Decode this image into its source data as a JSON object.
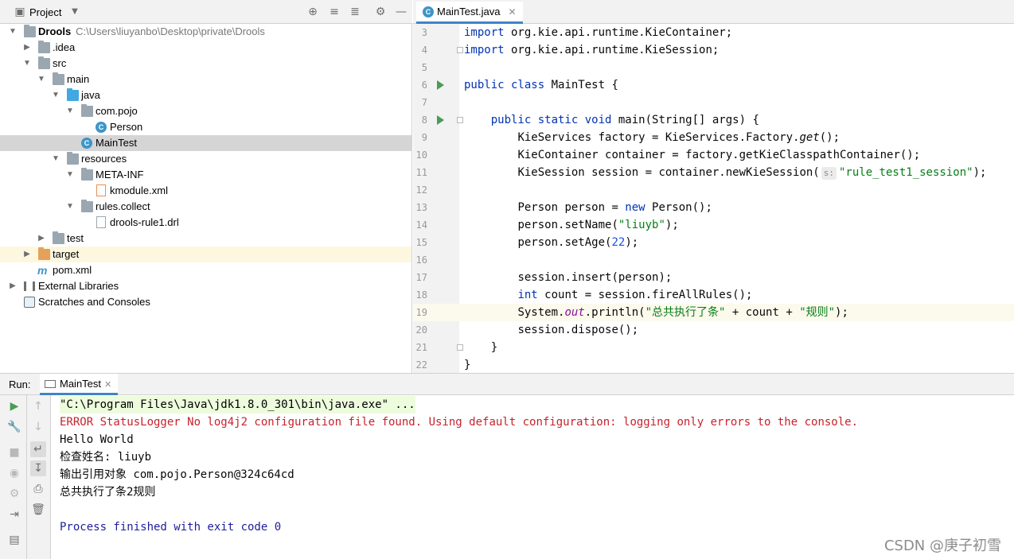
{
  "project": {
    "title": "Project",
    "tree": [
      {
        "label": "Drools",
        "path": "C:\\Users\\liuyanbo\\Desktop\\private\\Drools",
        "icon": "module-folder-icon"
      },
      {
        "label": ".idea",
        "icon": "folder-icon"
      },
      {
        "label": "src",
        "icon": "folder-icon"
      },
      {
        "label": "main",
        "icon": "folder-icon"
      },
      {
        "label": "java",
        "icon": "source-folder-icon"
      },
      {
        "label": "com.pojo",
        "icon": "package-icon"
      },
      {
        "label": "Person",
        "icon": "class-icon"
      },
      {
        "label": "MainTest",
        "icon": "runnable-class-icon"
      },
      {
        "label": "resources",
        "icon": "resources-folder-icon"
      },
      {
        "label": "META-INF",
        "icon": "folder-icon"
      },
      {
        "label": "kmodule.xml",
        "icon": "xml-file-icon"
      },
      {
        "label": "rules.collect",
        "icon": "folder-icon"
      },
      {
        "label": "drools-rule1.drl",
        "icon": "file-icon"
      },
      {
        "label": "test",
        "icon": "folder-icon"
      },
      {
        "label": "target",
        "icon": "excluded-folder-icon"
      },
      {
        "label": "pom.xml",
        "icon": "maven-icon"
      },
      {
        "label": "External Libraries",
        "icon": "library-icon"
      },
      {
        "label": "Scratches and Consoles",
        "icon": "scratches-icon"
      }
    ]
  },
  "editor": {
    "tab_label": "MainTest.java",
    "line_numbers": [
      "3",
      "4",
      "5",
      "6",
      "7",
      "8",
      "9",
      "10",
      "11",
      "12",
      "13",
      "14",
      "15",
      "16",
      "17",
      "18",
      "19",
      "20",
      "21",
      "22"
    ],
    "hint_label": "s:",
    "code": {
      "l3_kw": "import",
      "l3_rest": " org.kie.api.runtime.KieContainer;",
      "l4_kw": "import",
      "l4_rest": " org.kie.api.runtime.KieSession;",
      "l6_kw": "public class",
      "l6_rest": " MainTest {",
      "l8_kw": "public static void",
      "l8_rest": " main(String[] args) {",
      "l9_a": "KieServices factory = KieServices.Factory.",
      "l9_m": "get",
      "l9_b": "();",
      "l10": "KieContainer container = factory.getKieClasspathContainer();",
      "l11_a": "KieSession session = container.newKieSession(",
      "l11_s": "\"rule_test1_session\"",
      "l11_b": ");",
      "l13_a": "Person person = ",
      "l13_kw": "new",
      "l13_b": " Person();",
      "l14_a": "person.setName(",
      "l14_s": "\"liuyb\"",
      "l14_b": ");",
      "l15_a": "person.setAge(",
      "l15_n": "22",
      "l15_b": ");",
      "l17": "session.insert(person);",
      "l18_kw": "int",
      "l18_rest": " count = session.fireAllRules();",
      "l19_a": "System.",
      "l19_out": "out",
      "l19_b": ".println(",
      "l19_s1": "\"总共执行了条\"",
      "l19_c": " + count + ",
      "l19_s2": "\"规则\"",
      "l19_d": ");",
      "l20": "session.dispose();",
      "l21": "}",
      "l22": "}"
    }
  },
  "run": {
    "label": "Run:",
    "tab_label": "MainTest",
    "output": [
      "\"C:\\Program Files\\Java\\jdk1.8.0_301\\bin\\java.exe\" ...",
      "ERROR StatusLogger No log4j2 configuration file found. Using default configuration: logging only errors to the console.",
      "Hello World",
      "检查姓名: liuyb",
      "输出引用对象 com.pojo.Person@324c64cd",
      "总共执行了条2规则",
      "",
      "Process finished with exit code 0"
    ]
  },
  "watermark": "CSDN @庚子初雪",
  "colors": {
    "keyword": "#0033b3",
    "string": "#067d17",
    "number": "#1750eb",
    "error": "#c7222d",
    "selection_tab": "#4083c9",
    "run_green": "#499c54"
  }
}
